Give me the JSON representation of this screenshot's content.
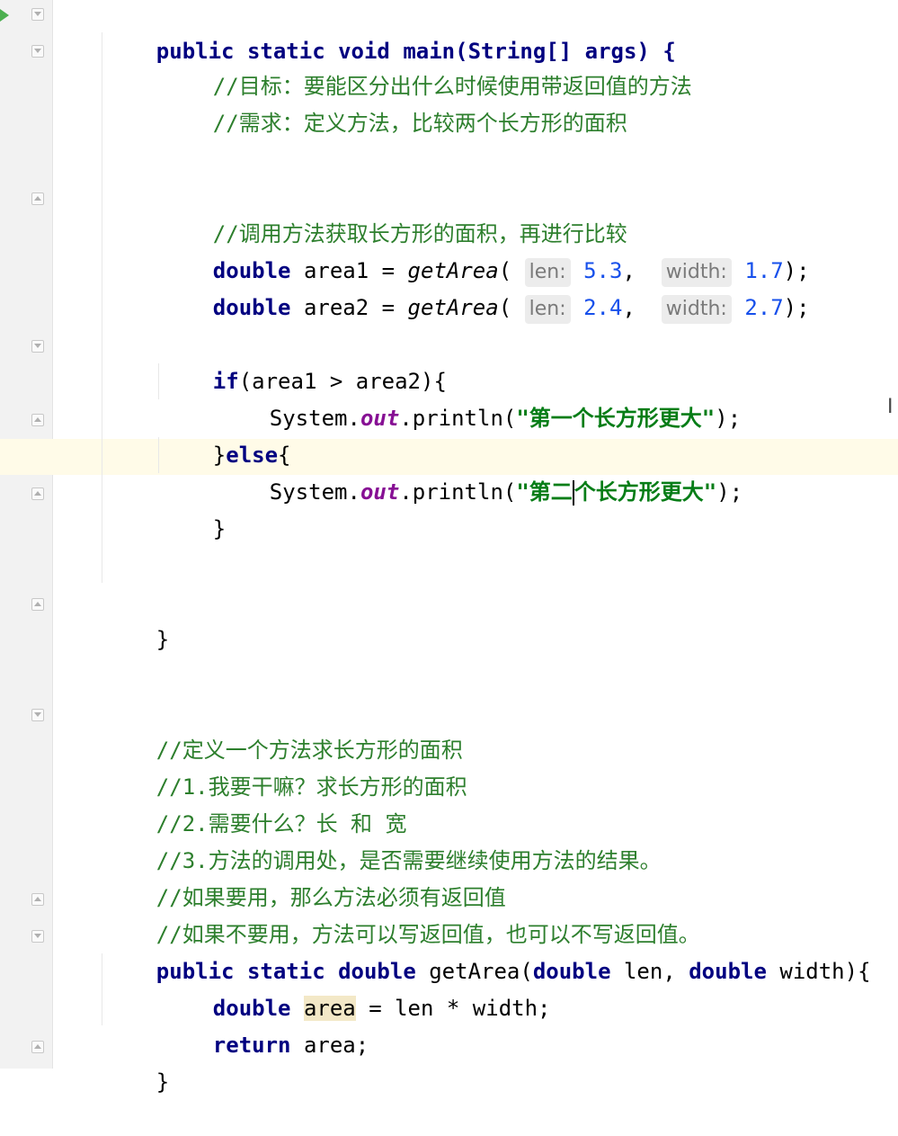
{
  "main_method": {
    "signature": "public static void main(String[] args) {",
    "comment_goal": "//目标：要能区分出什么时候使用带返回值的方法",
    "comment_need": "//需求：定义方法，比较两个长方形的面积",
    "comment_call": "//调用方法获取长方形的面积，再进行比较",
    "area1": {
      "kw": "double",
      "decl": " area1 = ",
      "call": "getArea",
      "hint1": "len:",
      "val1": "5.3",
      "hint2": "width:",
      "val2": "1.7"
    },
    "area2": {
      "kw": "double",
      "decl": " area2 = ",
      "call": "getArea",
      "hint1": "len:",
      "val1": "2.4",
      "hint2": "width:",
      "val2": "2.7"
    },
    "if_kw": "if",
    "if_cond": "(area1 > area2){",
    "print1_prefix": "System.",
    "out_field": "out",
    "print_call": ".println(",
    "print1_string": "\"第一个长方形更大\"",
    "print_end": ");",
    "else_open": "}",
    "else_kw": "else",
    "else_brace": "{",
    "print2_string_a": "\"第二",
    "print2_string_b": "个长方形更大\"",
    "close_if": "}",
    "close_main": "}"
  },
  "method_comments": [
    "//定义一个方法求长方形的面积",
    "//1.我要干嘛？求长方形的面积",
    "//2.需要什么？长 和 宽",
    "//3.方法的调用处，是否需要继续使用方法的结果。",
    "//如果要用，那么方法必须有返回值",
    "//如果不要用，方法可以写返回值，也可以不写返回值。"
  ],
  "get_area_method": {
    "mods": "public static double ",
    "name": "getArea(",
    "p1_type": "double",
    "p1_name": " len, ",
    "p2_type": "double",
    "p2_name": " width){",
    "body_kw": "double",
    "body_var": "area",
    "body_expr": " = len * width;",
    "return_kw": "return",
    "return_expr": " area;",
    "close": "}"
  },
  "colors": {
    "keyword": "#000080",
    "comment": "#2d7f2d",
    "string": "#067d17",
    "number": "#1750eb",
    "field": "#871094",
    "caret_line": "#fffbe8"
  }
}
